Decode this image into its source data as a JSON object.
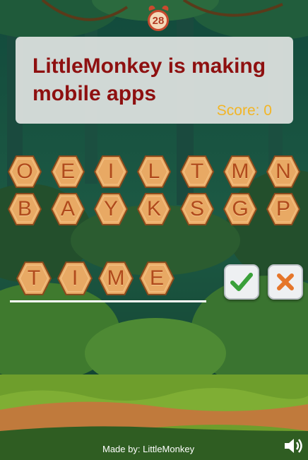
{
  "timer": {
    "value": "28"
  },
  "panel": {
    "message": "LittleMonkey is making mobile apps",
    "score": "Score: 0"
  },
  "letters_row1": [
    "O",
    "E",
    "I",
    "L",
    "T",
    "M",
    "N"
  ],
  "letters_row2": [
    "B",
    "A",
    "Y",
    "K",
    "S",
    "G",
    "P"
  ],
  "answer": [
    "T",
    "I",
    "M",
    "E"
  ],
  "footer": {
    "made_by": "Made by: LittleMonkey"
  },
  "colors": {
    "message": "#8e1010",
    "score": "#f2b526",
    "tile": "#e8a964",
    "confirm": "#3aa03a",
    "cancel": "#e5762a"
  },
  "icons": {
    "confirm": "check-icon",
    "cancel": "cross-icon",
    "sound": "speaker-icon",
    "timer": "alarm-clock-icon"
  }
}
